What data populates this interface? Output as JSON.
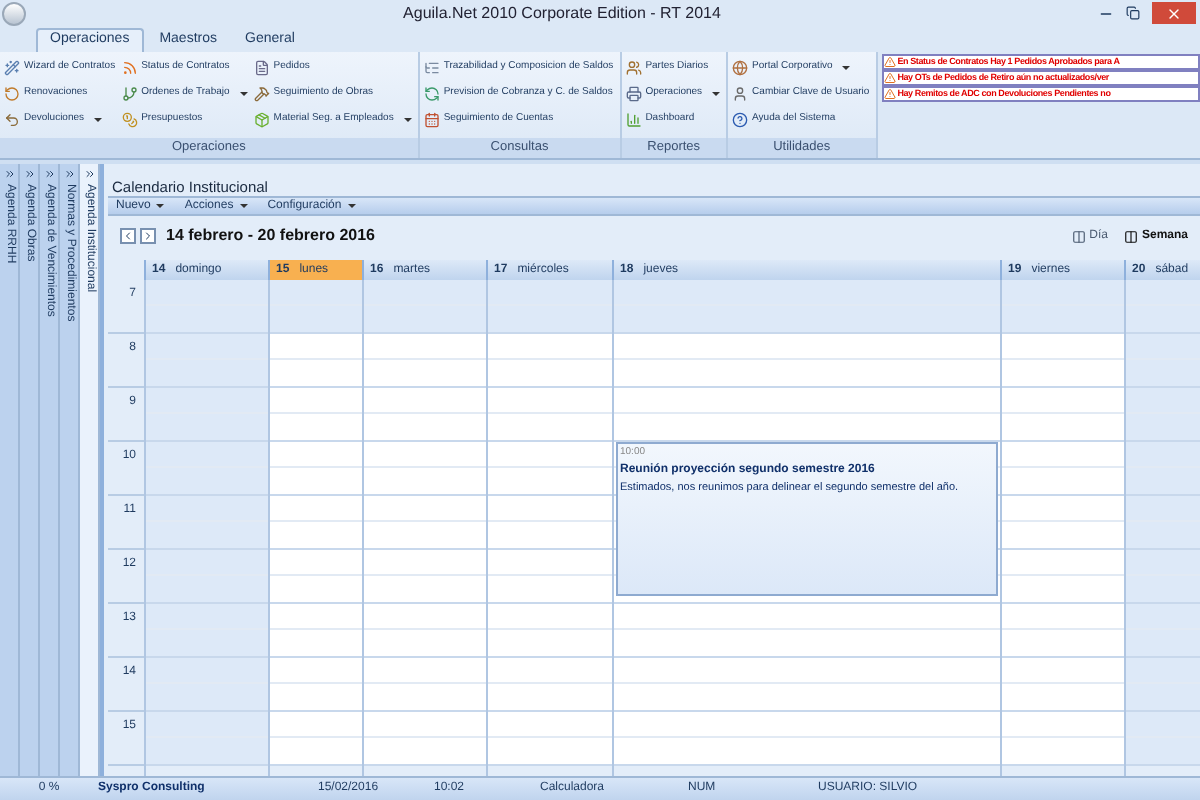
{
  "window": {
    "title": "Aguila.Net 2010 Corporate Edition - RT 2014"
  },
  "tabs": [
    {
      "label": "Operaciones",
      "selected": true
    },
    {
      "label": "Maestros",
      "selected": false
    },
    {
      "label": "General",
      "selected": false
    }
  ],
  "ribbon_groups": [
    {
      "title": "Operaciones",
      "columns": [
        [
          {
            "label": "Wizard de Contratos",
            "dropdown": false
          },
          {
            "label": "Renovaciones",
            "dropdown": false
          },
          {
            "label": "Devoluciones",
            "dropdown": true
          }
        ],
        [
          {
            "label": "Status de Contratos",
            "dropdown": false
          },
          {
            "label": "Ordenes de Trabajo",
            "dropdown": true
          },
          {
            "label": "Presupuestos",
            "dropdown": false
          }
        ],
        [
          {
            "label": "Pedidos",
            "dropdown": false
          },
          {
            "label": "Seguimiento de Obras",
            "dropdown": false
          },
          {
            "label": "Material Seg. a Empleados",
            "dropdown": true
          }
        ]
      ]
    },
    {
      "title": "Consultas",
      "columns": [
        [
          {
            "label": "Trazabilidad y Composicion de Saldos",
            "dropdown": false
          },
          {
            "label": "Prevision de Cobranza y C. de Saldos",
            "dropdown": false
          },
          {
            "label": "Seguimiento de Cuentas",
            "dropdown": false
          }
        ]
      ]
    },
    {
      "title": "Reportes",
      "columns": [
        [
          {
            "label": "Partes Diarios",
            "dropdown": false
          },
          {
            "label": "Operaciones",
            "dropdown": true
          },
          {
            "label": "Dashboard",
            "dropdown": false
          }
        ]
      ]
    },
    {
      "title": "Utilidades",
      "columns": [
        [
          {
            "label": "Portal Corporativo",
            "dropdown": true
          },
          {
            "label": "Cambiar Clave de Usuario",
            "dropdown": false
          },
          {
            "label": "Ayuda del Sistema",
            "dropdown": false
          }
        ]
      ]
    }
  ],
  "alerts": [
    "En Status de Contratos Hay 1 Pedidos Aprobados para A",
    "Hay OTs de Pedidos de Retiro aún no actualizados/ver",
    "Hay Remitos de ADC con Devoluciones Pendientes no"
  ],
  "side_tabs": [
    {
      "label": "Agenda RRHH",
      "selected": false
    },
    {
      "label": "Agenda Obras",
      "selected": false
    },
    {
      "label": "Agenda de Vencimientos",
      "selected": false
    },
    {
      "label": "Normas y Procedimientos",
      "selected": false
    },
    {
      "label": "Agenda Institucional",
      "selected": true
    }
  ],
  "calendar": {
    "title": "Calendario Institucional",
    "menu": [
      "Nuevo",
      "Acciones",
      "Configuración"
    ],
    "range": "14 febrero - 20 febrero 2016",
    "views": [
      {
        "label": "Día",
        "selected": false
      },
      {
        "label": "Semana",
        "selected": true
      }
    ],
    "days": [
      {
        "number": "14",
        "name": "domingo",
        "today": false,
        "weekend": true
      },
      {
        "number": "15",
        "name": "lunes",
        "today": true,
        "weekend": false
      },
      {
        "number": "16",
        "name": "martes",
        "today": false,
        "weekend": false
      },
      {
        "number": "17",
        "name": "miércoles",
        "today": false,
        "weekend": false
      },
      {
        "number": "18",
        "name": "jueves",
        "today": false,
        "weekend": false,
        "events": [
          {
            "time": "10:00",
            "title": "Reunión proyección segundo semestre 2016",
            "description": "Estimados, nos reunimos para delinear el segundo semestre del año."
          }
        ]
      },
      {
        "number": "19",
        "name": "viernes",
        "today": false,
        "weekend": false
      },
      {
        "number": "20",
        "name": "sábad",
        "today": false,
        "weekend": true
      }
    ],
    "hours": [
      {
        "label": "7",
        "off": true
      },
      {
        "label": "8",
        "off": false
      },
      {
        "label": "9",
        "off": false
      },
      {
        "label": "10",
        "off": false
      },
      {
        "label": "11",
        "off": false
      },
      {
        "label": "12",
        "off": false
      },
      {
        "label": "13",
        "off": false
      },
      {
        "label": "14",
        "off": false
      },
      {
        "label": "15",
        "off": false
      }
    ]
  },
  "status_bar": [
    "0 %",
    "Syspro Consulting",
    "15/02/2016",
    "10:02",
    "Calculadora",
    "NUM",
    "USUARIO: SILVIO"
  ]
}
